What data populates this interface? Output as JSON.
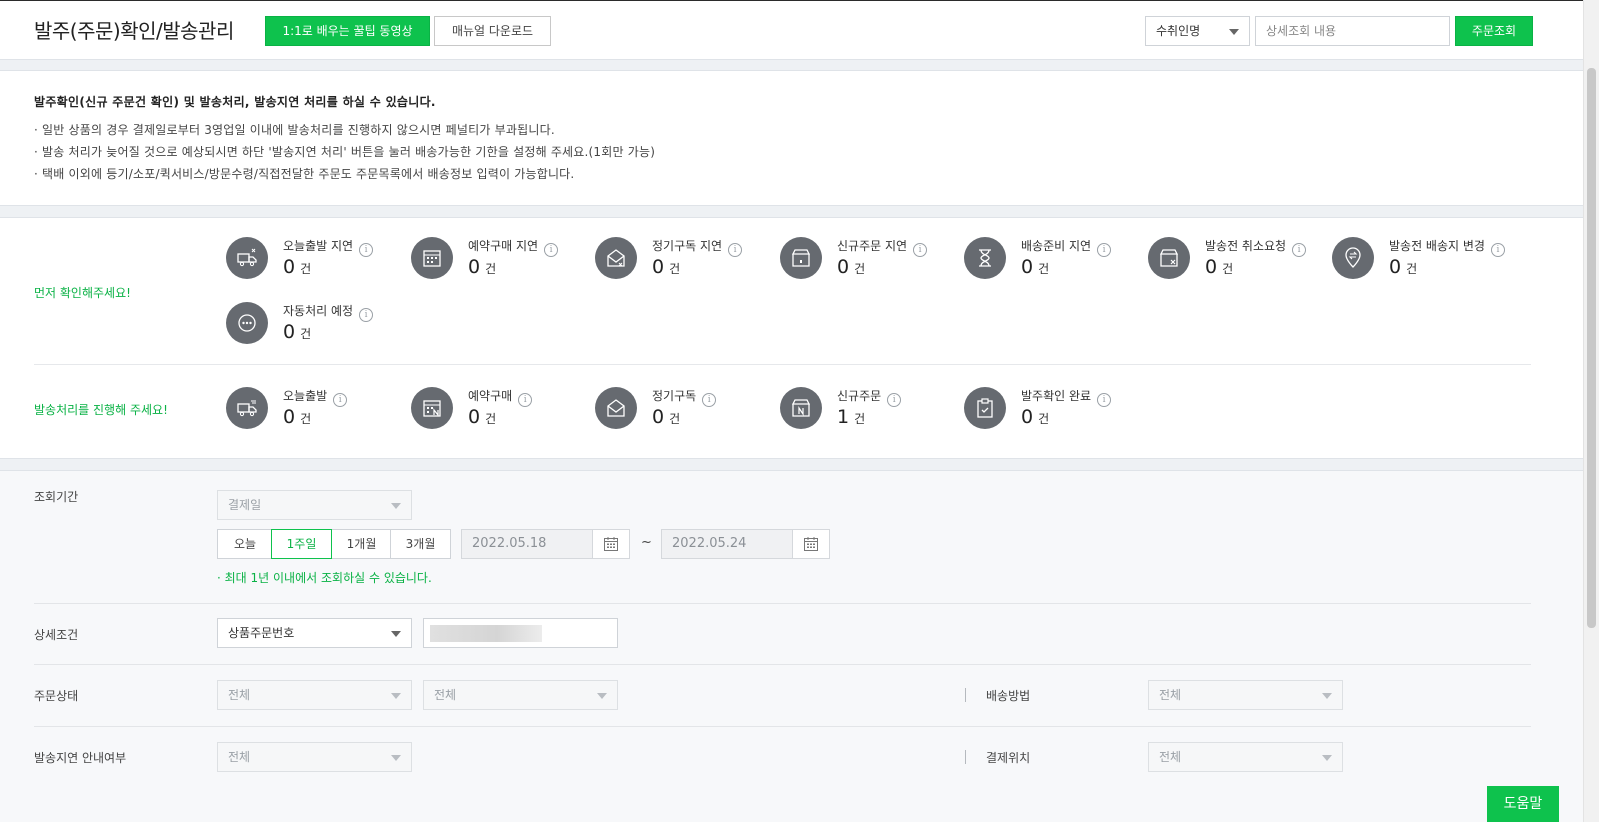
{
  "header": {
    "title": "발주(주문)확인/발송관리",
    "tip_video_button": "1:1로 배우는 꿀팁 동영상",
    "manual_button": "매뉴얼 다운로드",
    "search_type": "수취인명",
    "search_placeholder": "상세조회 내용",
    "search_button": "주문조회"
  },
  "notice": {
    "title": "발주확인(신규 주문건 확인) 및 발송처리, 발송지연 처리를 하실 수 있습니다.",
    "lines": [
      "· 일반 상품의 경우 결제일로부터 3영업일 이내에 발송처리를 진행하지 않으시면 페널티가 부과됩니다.",
      "· 발송 처리가 늦어질 것으로 예상되시면 하단 '발송지연 처리' 버튼을 눌러 배송가능한 기한을 설정해 주세요.(1회만 가능)",
      "· 택배 이외에 등기/소포/퀵서비스/방문수령/직접전달한 주문도 주문목록에서 배송정보 입력이 가능합니다."
    ]
  },
  "status": {
    "first_label": "먼저 확인해주세요!",
    "second_label": "발송처리를 진행해 주세요!",
    "unit": "건",
    "info_glyph": "i",
    "delayed": [
      {
        "label": "오늘출발 지연",
        "count": "0",
        "icon": "truck-clock-icon"
      },
      {
        "label": "예약구매 지연",
        "count": "0",
        "icon": "calendar-clock-icon"
      },
      {
        "label": "정기구독 지연",
        "count": "0",
        "icon": "mail-clock-icon"
      },
      {
        "label": "신규주문 지연",
        "count": "0",
        "icon": "box-clock-icon"
      },
      {
        "label": "배송준비 지연",
        "count": "0",
        "icon": "hourglass-icon"
      },
      {
        "label": "발송전 취소요청",
        "count": "0",
        "icon": "box-cancel-icon"
      },
      {
        "label": "발송전 배송지 변경",
        "count": "0",
        "icon": "location-change-icon"
      },
      {
        "label": "자동처리 예정",
        "count": "0",
        "icon": "more-dots-icon"
      }
    ],
    "process": [
      {
        "label": "오늘출발",
        "count": "0",
        "icon": "truck-icon"
      },
      {
        "label": "예약구매",
        "count": "0",
        "icon": "calendar-n-icon"
      },
      {
        "label": "정기구독",
        "count": "0",
        "icon": "mail-icon"
      },
      {
        "label": "신규주문",
        "count": "1",
        "icon": "box-n-icon"
      },
      {
        "label": "발주확인 완료",
        "count": "0",
        "icon": "clipboard-check-icon"
      }
    ]
  },
  "search": {
    "period_label": "조회기간",
    "date_type": "결제일",
    "periods": [
      "오늘",
      "1주일",
      "1개월",
      "3개월"
    ],
    "active_period": "1주일",
    "start_date": "2022.05.18",
    "date_sep": "~",
    "end_date": "2022.05.24",
    "period_hint": "· 최대 1년 이내에서 조회하실 수 있습니다.",
    "detail_label": "상세조건",
    "detail_type": "상품주문번호",
    "status_label": "주문상태",
    "status_value1": "전체",
    "status_value2": "전체",
    "delivery_method_label": "배송방법",
    "delivery_method_value": "전체",
    "delay_notice_label": "발송지연 안내여부",
    "delay_notice_value": "전체",
    "payment_location_label": "결제위치",
    "payment_location_value": "전체"
  },
  "help_button": "도움말",
  "colors": {
    "accent": "#0ec24d",
    "icon_bg": "#666a70",
    "page_bg": "#eef1f4"
  }
}
